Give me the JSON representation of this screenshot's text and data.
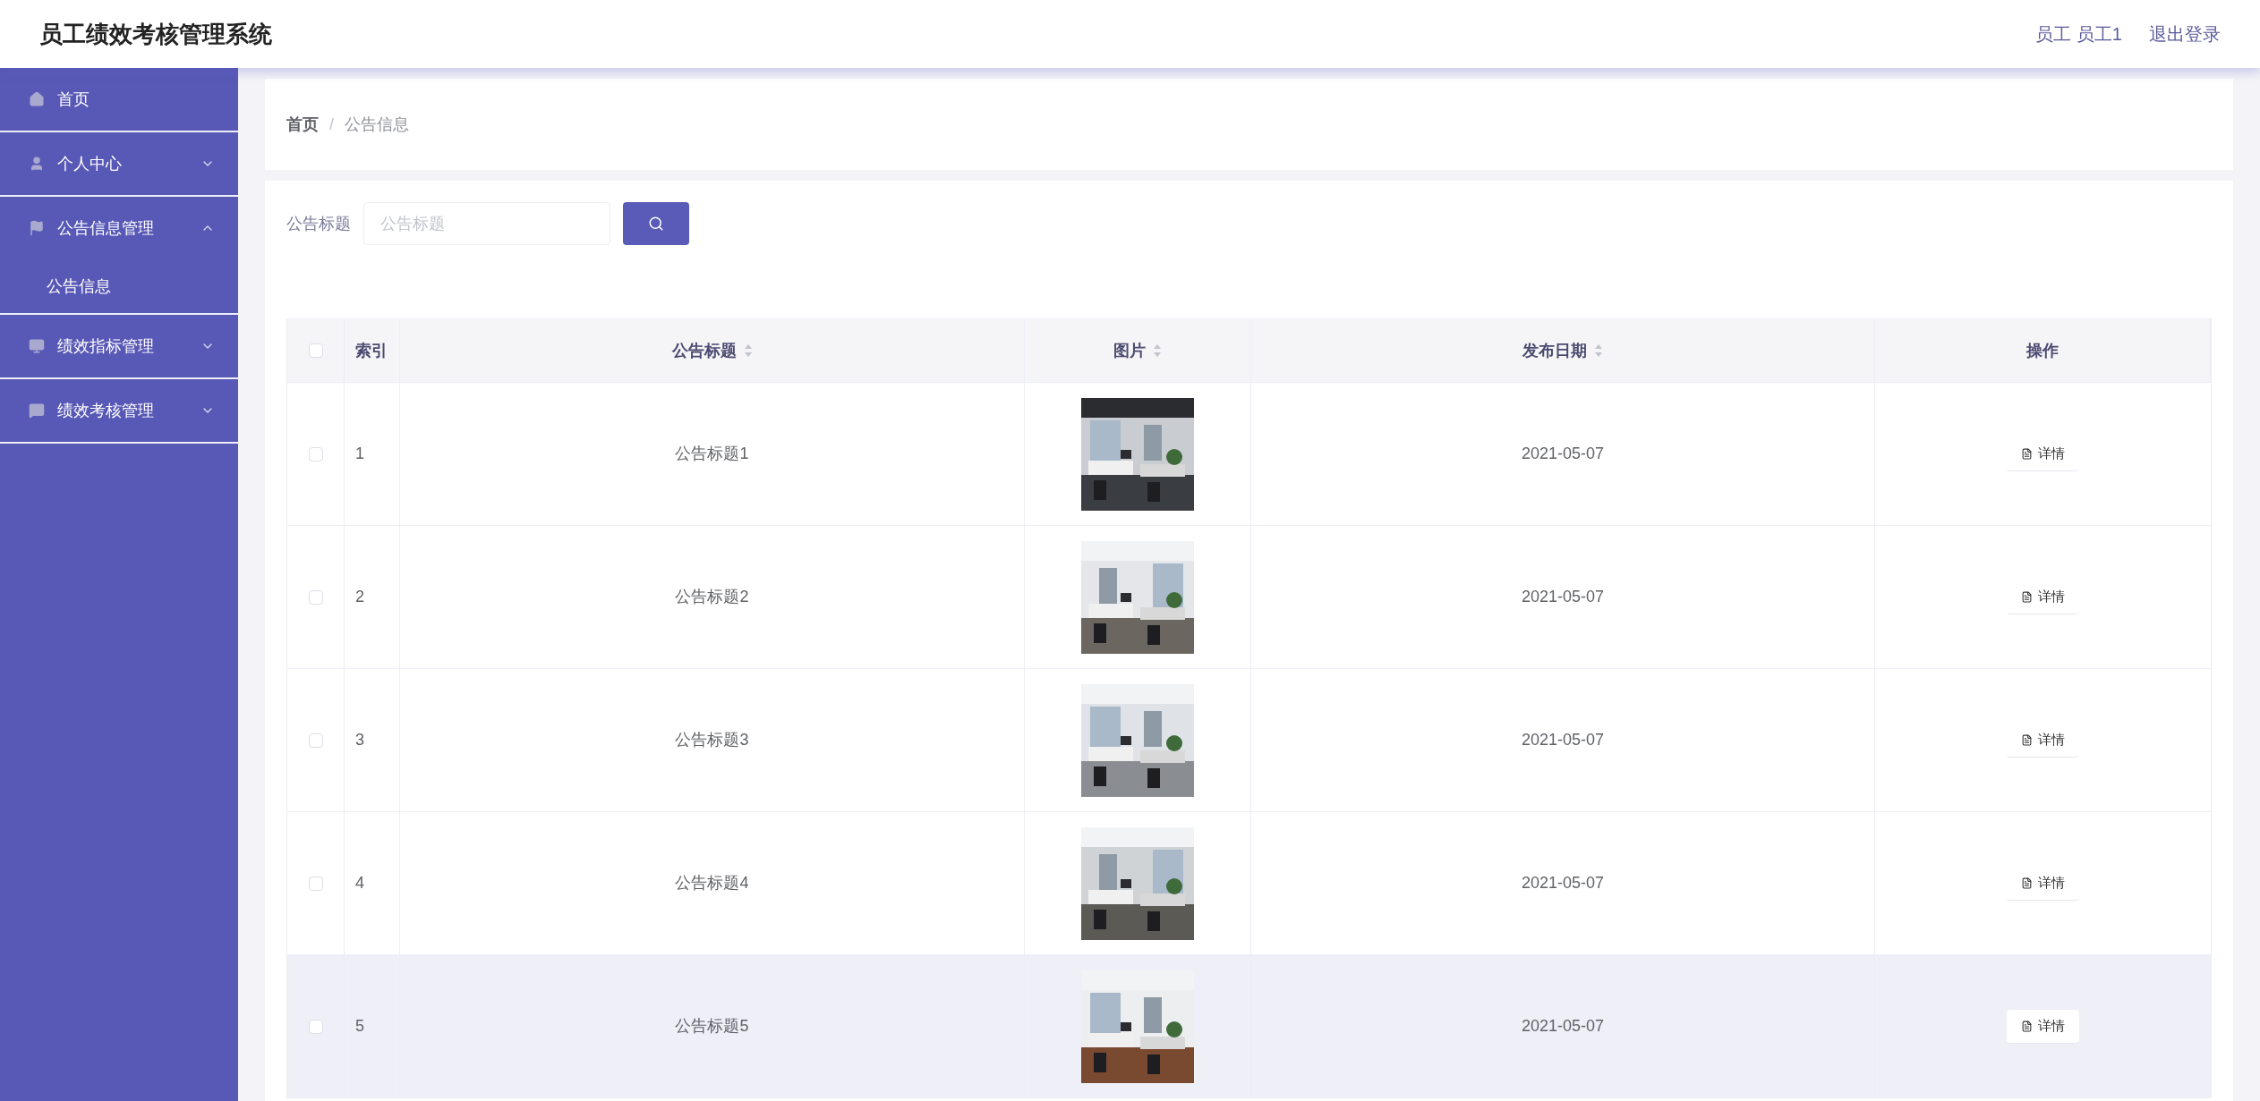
{
  "header": {
    "title": "员工绩效考核管理系统",
    "user": "员工 员工1",
    "logout": "退出登录"
  },
  "sidebar": {
    "items": [
      {
        "label": "首页",
        "kind": "link"
      },
      {
        "label": "个人中心",
        "kind": "group",
        "expanded": false
      },
      {
        "label": "公告信息管理",
        "kind": "group",
        "expanded": true,
        "children": [
          {
            "label": "公告信息"
          }
        ]
      },
      {
        "label": "绩效指标管理",
        "kind": "group",
        "expanded": false
      },
      {
        "label": "绩效考核管理",
        "kind": "group",
        "expanded": false
      }
    ]
  },
  "breadcrumb": {
    "items": [
      "首页",
      "公告信息"
    ],
    "separator": "/"
  },
  "search": {
    "label": "公告标题",
    "placeholder": "公告标题"
  },
  "table": {
    "all_selected": false,
    "columns": [
      {
        "label": "索引",
        "sortable": false
      },
      {
        "label": "公告标题",
        "sortable": true
      },
      {
        "label": "图片",
        "sortable": true
      },
      {
        "label": "发布日期",
        "sortable": true
      },
      {
        "label": "操作",
        "sortable": false
      }
    ],
    "rows": [
      {
        "selected": false,
        "highlighted": false,
        "index": "1",
        "title": "公告标题1",
        "date": "2021-05-07",
        "action": "详情"
      },
      {
        "selected": false,
        "highlighted": false,
        "index": "2",
        "title": "公告标题2",
        "date": "2021-05-07",
        "action": "详情"
      },
      {
        "selected": false,
        "highlighted": false,
        "index": "3",
        "title": "公告标题3",
        "date": "2021-05-07",
        "action": "详情"
      },
      {
        "selected": false,
        "highlighted": false,
        "index": "4",
        "title": "公告标题4",
        "date": "2021-05-07",
        "action": "详情"
      },
      {
        "selected": false,
        "highlighted": true,
        "index": "5",
        "title": "公告标题5",
        "date": "2021-05-07",
        "action": "详情"
      }
    ]
  }
}
